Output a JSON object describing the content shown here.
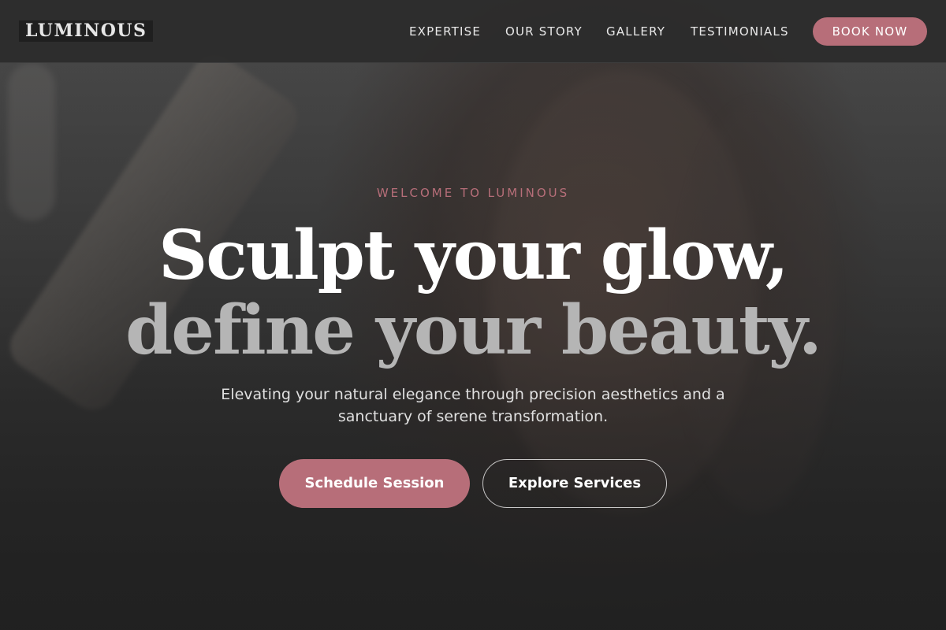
{
  "brand": {
    "logo_text": "LUMINOUS",
    "accent_color": "#b76e79"
  },
  "nav": {
    "items": [
      {
        "label": "EXPERTISE"
      },
      {
        "label": "OUR STORY"
      },
      {
        "label": "GALLERY"
      },
      {
        "label": "TESTIMONIALS"
      }
    ],
    "cta_label": "BOOK NOW"
  },
  "hero": {
    "eyebrow": "WELCOME TO LUMINOUS",
    "headline_line1": "Sculpt your glow,",
    "headline_line2": "define your beauty.",
    "subtext": "Elevating your natural elegance through precision aesthetics and a sanctuary of serene transformation.",
    "primary_cta": "Schedule Session",
    "secondary_cta": "Explore Services"
  }
}
